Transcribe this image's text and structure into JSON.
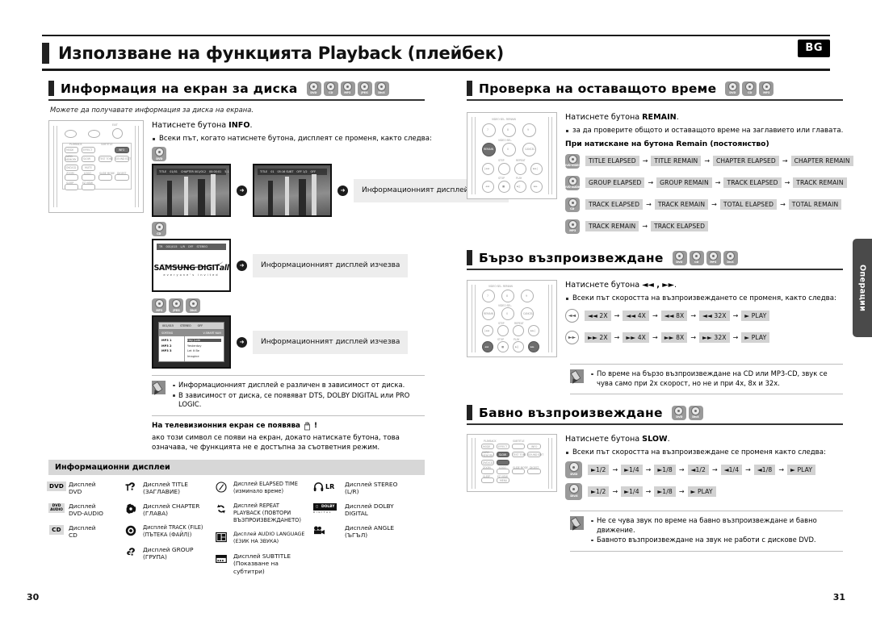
{
  "document": {
    "title": "Използване на функцията Playback (плейбек)",
    "language_badge": "BG",
    "side_tab": "Операции",
    "page_left": "30",
    "page_right": "31"
  },
  "disc_labels": {
    "dvd": "DVD",
    "cd": "CD",
    "mp3": "MP3",
    "jpeg": "JPEG",
    "divx": "DivX",
    "dvd_video": "DVD-VIDEO",
    "dvd_audio": "DVD-AUDIO"
  },
  "sections": {
    "disc_info": {
      "title": "Информация на екран за диска",
      "icons": [
        "DVD",
        "CD",
        "MP3",
        "JPEG",
        "DivX"
      ],
      "subtitle": "Можете да получавате информация за диска на екрана.",
      "lead_prefix": "Натиснете бутона ",
      "lead_button": "INFO",
      "lead_suffix": ".",
      "bullet": "Всеки път, когато натиснете бутона, дисплеят се променя, както следва:",
      "callout": "Информационният дисплей изчезва",
      "osd_row_1": [
        "TITLE",
        "01/01",
        "CHAPTER 001/012",
        "00:00:01",
        "5.1 CH"
      ],
      "osd_row_2": [
        "TITLE",
        "01",
        "05:16  SUBT",
        "OFF 1/2",
        "OFF"
      ],
      "osd_cd": [
        "TR",
        "001/015",
        "L/R",
        "OFF",
        "STEREO"
      ],
      "samsung_logo": "SAMSUNG DIGIT",
      "samsung_logo_italic": "all",
      "samsung_tagline": "everyone's invited",
      "mp3_top": [
        "001/015",
        "STEREO",
        "OFF"
      ],
      "mp3_bar_left": "SORTING",
      "mp3_bar_right": "V-SMART NAVI",
      "mp3_left_items": [
        "MP3 1",
        "MP3 2",
        "MP3 3"
      ],
      "mp3_right_items": [
        "Hey Jude",
        "Yesterday",
        "Let It Be",
        "Imagine"
      ],
      "notes": [
        "Информационният дисплей е различен в зависимост от диска.",
        "В зависимост от диска, се появяват DTS, DOLBY DIGITAL или PRO LOGIC."
      ],
      "tv_note_head": "На телевизионния екран се появява",
      "tv_note_head_suffix": "!",
      "tv_note_body": "ако този символ се появи на екран, докато натискате бутона, това означава, че функцията не е достъпна за съответния режим."
    },
    "info_displays": {
      "heading": "Информационни дисплеи",
      "columns": [
        [
          {
            "icon": "pill-dvd",
            "icon_text": "DVD",
            "line1": "Дисплей",
            "line2": "DVD"
          },
          {
            "icon": "pill-dvd-audio",
            "icon_text": "DVD AUDIO",
            "line1": "Дисплей",
            "line2": "DVD-AUDIO"
          },
          {
            "icon": "pill-cd",
            "icon_text": "CD",
            "line1": "Дисплей",
            "line2": "CD"
          }
        ],
        [
          {
            "icon": "title-icon",
            "line1": "Дисплей TITLE",
            "line2": "(ЗАГЛАВИЕ)"
          },
          {
            "icon": "chapter-icon",
            "line1": "Дисплей CHAPTER",
            "line2": "(ГЛАВА)"
          },
          {
            "icon": "track-icon",
            "line1": "Дисплей TRACK (FILE)",
            "line2": "(ПЪТЕКА (ФАЙЛ))"
          },
          {
            "icon": "group-icon",
            "line1": "Дисплей GROUP",
            "line2": "(ГРУПА)"
          }
        ],
        [
          {
            "icon": "clock-icon",
            "line1": "Дисплей ELAPSED TIME",
            "line2": "(изминало време)"
          },
          {
            "icon": "repeat-icon",
            "line1": "Дисплей REPEAT",
            "line2": "PLAYBACK (ПОВТОРИ",
            "line3": "ВЪЗПРОИЗВЕЖДАНЕТО)"
          },
          {
            "icon": "audio-language-icon",
            "line1": "Дисплей AUDIO LANGUAGE",
            "line2": "(ЕЗИК НА ЗВУКА)"
          },
          {
            "icon": "subtitle-icon",
            "line1": "Дисплей SUBTITLE",
            "line2": "(Показване на",
            "line3": "субтитри)"
          }
        ],
        [
          {
            "icon": "headphones-icon",
            "icon_text": "LR",
            "line1": "Дисплей STEREO",
            "line2": "(L/R)"
          },
          {
            "icon": "dolby-digital-icon",
            "icon_text": "DOLBY",
            "icon_sub": "D I G I T A L",
            "line1": "Дисплей DOLBY",
            "line2": "DIGITAL"
          },
          {
            "icon": "angle-camera-icon",
            "line1": "Дисплей ANGLE",
            "line2": "(ЪГЪЛ)"
          }
        ]
      ]
    },
    "remaining_time": {
      "title": "Проверка на оставащото време",
      "icons": [
        "DVD",
        "CD",
        "MP3"
      ],
      "lead_prefix": "Натиснете бутона ",
      "lead_button": "REMAIN",
      "lead_suffix": ".",
      "bullet": "за да проверите общото и оставащото време на заглавието или главата.",
      "sub_bold": "При натискане на бутона Remain (постоянство)",
      "flows": [
        {
          "disc": "DVD-VIDEO",
          "steps": [
            "TITLE ELAPSED",
            "TITLE REMAIN",
            "CHAPTER ELAPSED",
            "CHAPTER REMAIN"
          ]
        },
        {
          "disc": "DVD-AUDIO",
          "steps": [
            "GROUP ELAPSED",
            "GROUP REMAIN",
            "TRACK ELAPSED",
            "TRACK REMAIN"
          ]
        },
        {
          "disc": "CD",
          "steps": [
            "TRACK ELAPSED",
            "TRACK REMAIN",
            "TOTAL ELAPSED",
            "TOTAL REMAIN"
          ]
        },
        {
          "disc": "MP3",
          "steps": [
            "TRACK REMAIN",
            "TRACK ELAPSED"
          ]
        }
      ]
    },
    "fast_playback": {
      "title": "Бързо възпроизвеждане",
      "icons": [
        "DVD",
        "CD",
        "MP3",
        "DivX"
      ],
      "lead_prefix": "Натиснете бутона ",
      "lead_button": "◄◄ , ►►",
      "lead_suffix": ".",
      "bullet": "Всеки път скоростта на възпроизвеждането се променя, както следва:",
      "flows": [
        {
          "dir": "rew",
          "steps": [
            "◄◄ 2X",
            "◄◄ 4X",
            "◄◄ 8X",
            "◄◄ 32X",
            "► PLAY"
          ]
        },
        {
          "dir": "ff",
          "steps": [
            "►► 2X",
            "►► 4X",
            "►► 8X",
            "►► 32X",
            "► PLAY"
          ]
        }
      ],
      "notes": [
        "По време на бързо възпроизвеждане на CD или MP3-CD, звук се чува само при 2x скорост, но не и при 4x, 8x и 32x."
      ]
    },
    "slow_playback": {
      "title": "Бавно възпроизвеждане",
      "icons": [
        "DVD",
        "DivX"
      ],
      "lead_prefix": "Натиснете бутона ",
      "lead_button": "SLOW",
      "lead_suffix": ".",
      "bullet": "Всеки път скоростта на възпроизвеждане се променя както следва:",
      "flows": [
        {
          "disc": "DVD",
          "steps": [
            "►1/2",
            "►1/4",
            "►1/8",
            "◄1/2",
            "◄1/4",
            "◄1/8",
            "► PLAY"
          ]
        },
        {
          "disc": "DivX",
          "steps": [
            "►1/2",
            "►1/4",
            "►1/8",
            "► PLAY"
          ]
        }
      ],
      "notes": [
        "Не се чува звук по време на бавно възпроизвеждане и бавно движение.",
        "Бавното възпроизвеждане на звук не работи с дискове DVD."
      ]
    }
  },
  "remote_labels": {
    "info": "INFO",
    "slow": "SLOW",
    "remain": "REMAIN",
    "mode": "MODE",
    "effect": "EFFECT",
    "card_memory": "CARD MEMORY",
    "video_sel": "VIDEO SEL.",
    "step": "STEP",
    "repeat": "REPEAT",
    "stop": "STOP",
    "play": "PLAY",
    "zoom": "ZOOM",
    "logo": "LOGO",
    "sleep": "SLEEP",
    "ez_view": "EZ VIEW",
    "menu": "MENU",
    "cancel": "CANCEL",
    "tv_tone": "TEST TONE",
    "sound_edit": "SOUND EDIT",
    "slide_mode": "SLIDE MODE",
    "digest": "DIGEST",
    "mute": "MUTE",
    "sound": "SOUND"
  },
  "colors": {
    "chip_bg": "#d2d2d2",
    "callout_bg": "#ededed",
    "table_head_bg": "#d7d7d7",
    "side_tab_bg": "#4a4a4a",
    "disc_badge_bg": "#9a9a9a",
    "ink": "#111111"
  }
}
